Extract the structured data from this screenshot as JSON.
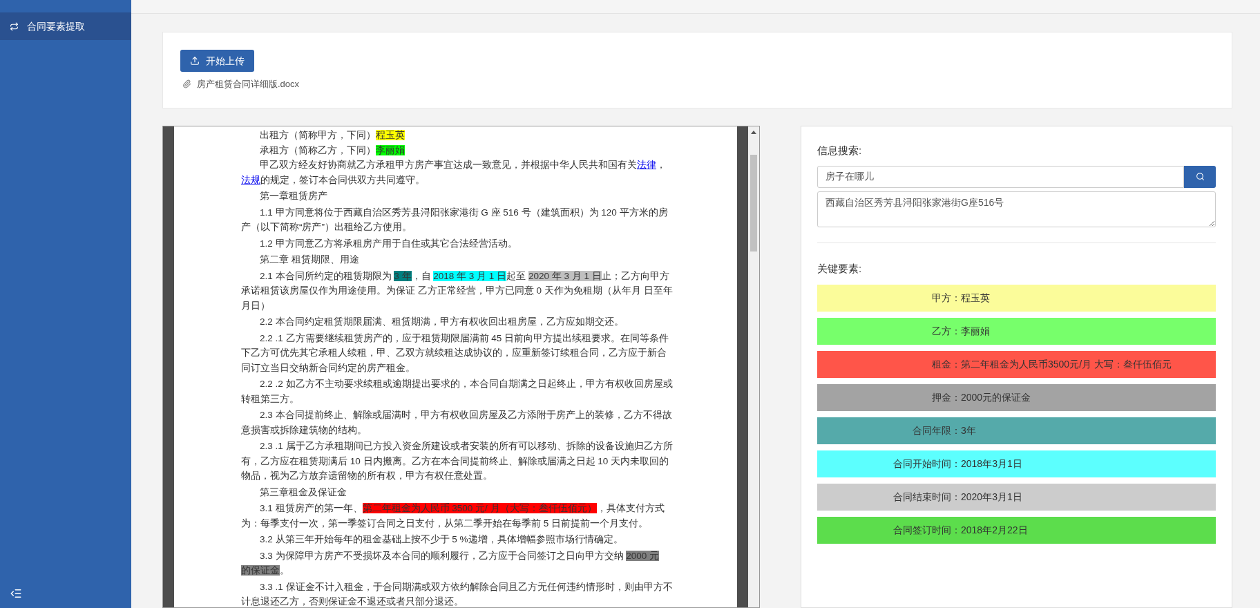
{
  "sidebar": {
    "items": [
      {
        "label": "合同要素提取",
        "selected": true
      }
    ]
  },
  "upload": {
    "button": "开始上传",
    "file": "房产租赁合同详细版.docx"
  },
  "document": {
    "paragraphs": [
      {
        "segments": [
          {
            "kind": "plain",
            "text": "出租方（简称甲方，下同）"
          },
          {
            "kind": "highlight",
            "text": "程玉英",
            "color": "#ffff00"
          }
        ]
      },
      {
        "segments": [
          {
            "kind": "plain",
            "text": "承租方（简称乙方，下同）"
          },
          {
            "kind": "highlight",
            "text": "李丽娟",
            "color": "#00ff00"
          }
        ]
      },
      {
        "segments": [
          {
            "kind": "plain",
            "text": "甲乙双方经友好协商就乙方承租甲方房产事宜达成一致意见，并根据中华人民共和国有关"
          },
          {
            "kind": "link",
            "text": "法律"
          },
          {
            "kind": "plain",
            "text": "，"
          },
          {
            "kind": "link",
            "text": "法规"
          },
          {
            "kind": "plain",
            "text": "的规定，签订本合同供双方共同遵守。"
          }
        ]
      },
      {
        "segments": [
          {
            "kind": "plain",
            "text": "第一章租赁房产"
          }
        ]
      },
      {
        "segments": [
          {
            "kind": "plain",
            "text": "1.1 甲方同意将位于西藏自治区秀芳县浔阳张家港街 G 座 516 号（建筑面积）为 120 平方米的房产（以下简称“房产”）出租给乙方使用。"
          }
        ]
      },
      {
        "segments": [
          {
            "kind": "plain",
            "text": "1.2 甲方同意乙方将承租房产用于自住或其它合法经营活动。"
          }
        ]
      },
      {
        "segments": [
          {
            "kind": "plain",
            "text": "第二章 租赁期限、用途"
          }
        ]
      },
      {
        "segments": [
          {
            "kind": "plain",
            "text": "2.1 本合同所约定的租赁期限为 "
          },
          {
            "kind": "highlight",
            "text": "3 年",
            "color": "#008080"
          },
          {
            "kind": "plain",
            "text": "，自 "
          },
          {
            "kind": "highlight",
            "text": "2018 年 3 月 1 日",
            "color": "#00ffff"
          },
          {
            "kind": "plain",
            "text": "起至 "
          },
          {
            "kind": "highlight",
            "text": "2020 年 3 月 1 日",
            "color": "#c0c0c0"
          },
          {
            "kind": "plain",
            "text": "止；乙方向甲方承诺租赁该房屋仅作为用途使用。为保证 乙方正常经营，甲方已同意 0 天作为免租期（从年月 日至年月日）"
          }
        ]
      },
      {
        "segments": [
          {
            "kind": "plain",
            "text": "2.2 本合同约定租赁期限届满、租赁期满，甲方有权收回出租房屋，乙方应如期交还。"
          }
        ]
      },
      {
        "segments": [
          {
            "kind": "plain",
            "text": "2.2 .1 乙方需要继续租赁房产的，应于租赁期限届满前 45 日前向甲方提出续租要求。在同等条件下乙方可优先其它承租人续租，甲、乙双方就续租达成协议的，应重新签订续租合同，乙方应于新合同订立当日交纳新合同约定的房产租金。"
          }
        ]
      },
      {
        "segments": [
          {
            "kind": "plain",
            "text": "2.2 .2 如乙方不主动要求续租或逾期提出要求的，本合同自期满之日起终止，甲方有权收回房屋或转租第三方。"
          }
        ]
      },
      {
        "segments": [
          {
            "kind": "plain",
            "text": "2.3 本合同提前终止、解除或届满时，甲方有权收回房屋及乙方添附于房产上的装修，乙方不得故意损害或拆除建筑物的结构。"
          }
        ]
      },
      {
        "segments": [
          {
            "kind": "plain",
            "text": "2.3 .1 属于乙方承租期间已方投入资金所建设或者安装的所有可以移动、拆除的设备设施归乙方所有，乙方应在租赁期满后 10 日内搬离。乙方在本合同提前终止、解除或届满之日起 10 天内未取回的物品，视为乙方放弃遗留物的所有权，甲方有权任意处置。"
          }
        ]
      },
      {
        "segments": [
          {
            "kind": "plain",
            "text": "第三章租金及保证金"
          }
        ]
      },
      {
        "segments": [
          {
            "kind": "plain",
            "text": "3.1 租赁房产的第一年、"
          },
          {
            "kind": "highlight",
            "text": "第二年租金为人民币 3500 元/ 月（大写：叁仟伍佰元）",
            "color": "#ff0000"
          },
          {
            "kind": "plain",
            "text": "，具体支付方式为：每季支付一次，第一季签订合同之日支付，从第二季开始在每季前 5 日前提前一个月支付。"
          }
        ]
      },
      {
        "segments": [
          {
            "kind": "plain",
            "text": "3.2 从第三年开始每年的租金基础上按不少于 5 %递增，具体增幅参照市场行情确定。"
          }
        ]
      },
      {
        "segments": [
          {
            "kind": "plain",
            "text": "3.3 为保障甲方房产不受损坏及本合同的顺利履行，乙方应于合同签订之日向甲方交纳 "
          },
          {
            "kind": "highlight",
            "text": "2000 元",
            "color": "#808080"
          },
          {
            "kind": "highlight",
            "text": "的保证金",
            "color": "#808080"
          },
          {
            "kind": "plain",
            "text": "。"
          }
        ]
      },
      {
        "segments": [
          {
            "kind": "plain",
            "text": "3.3 .1 保证金不计入租金，于合同期满或双方依约解除合同且乙方无任何违约情形时，则由甲方不计息退还乙方，否则保证金不退还或者只部分退还。"
          }
        ]
      }
    ]
  },
  "search": {
    "title": "信息搜索:",
    "query": "房子在哪儿",
    "result": "西藏自治区秀芳县浔阳张家港街G座516号"
  },
  "elements": {
    "title": "关键要素:",
    "items": [
      {
        "label": "甲方：",
        "value": "程玉英",
        "color": "#fbfc9a"
      },
      {
        "label": "乙方：",
        "value": "李丽娟",
        "color": "#77ff6b"
      },
      {
        "label": "租金：",
        "value": "第二年租金为人民币3500元/月 大写：叁仟伍佰元",
        "color": "#ff5549"
      },
      {
        "label": "押金：",
        "value": "2000元的保证金",
        "color": "#a3a3a3"
      },
      {
        "label": "合同年限：",
        "value": "3年",
        "color": "#55aaaa"
      },
      {
        "label": "合同开始时间：",
        "value": "2018年3月1日",
        "color": "#5cfffe"
      },
      {
        "label": "合同结束时间：",
        "value": "2020年3月1日",
        "color": "#cccccc"
      },
      {
        "label": "合同签订时间：",
        "value": "2018年2月22日",
        "color": "#5cdd4c"
      }
    ]
  }
}
